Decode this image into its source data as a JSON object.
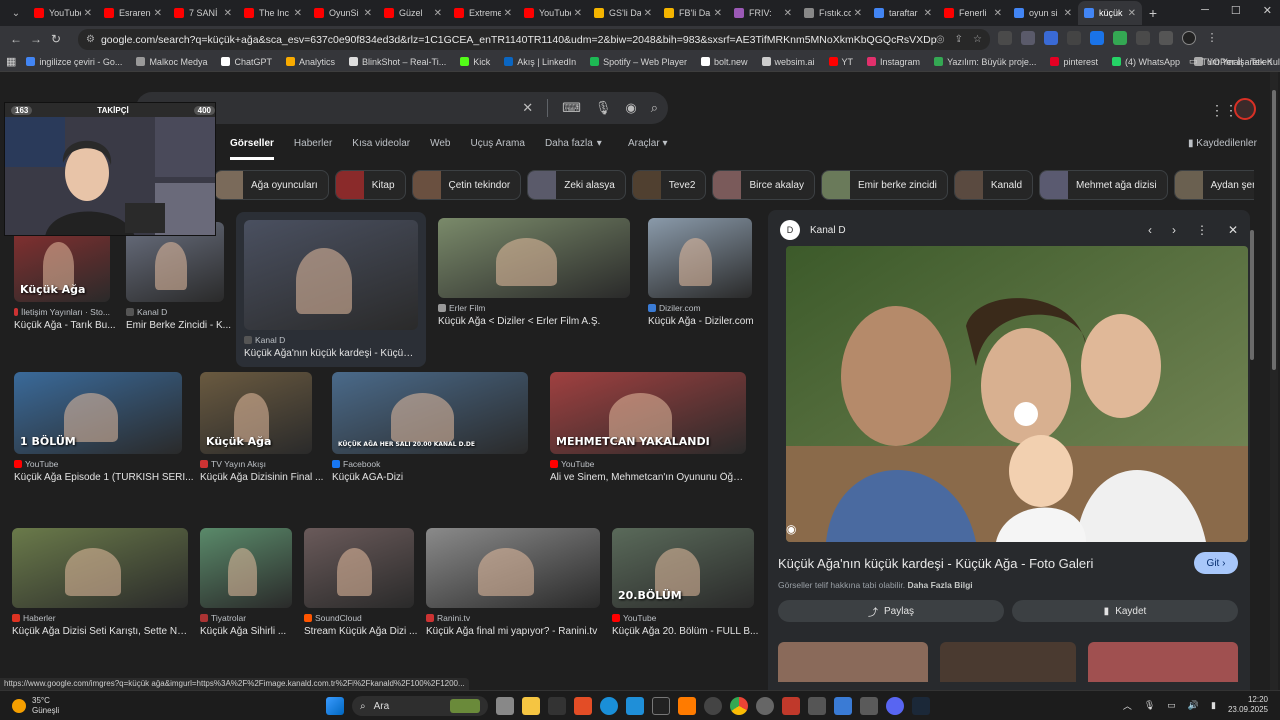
{
  "browser": {
    "tabs": [
      {
        "title": "YouTube",
        "color": "#ff0000"
      },
      {
        "title": "Esrarengiz",
        "color": "#ff0000"
      },
      {
        "title": "7 SANİ",
        "color": "#ff0000"
      },
      {
        "title": "The Inc",
        "color": "#ff0000"
      },
      {
        "title": "OyunSi",
        "color": "#ff0000"
      },
      {
        "title": "Güzel ",
        "color": "#ff0000"
      },
      {
        "title": "Extreme",
        "color": "#ff0000"
      },
      {
        "title": "YouTube",
        "color": "#ff0000"
      },
      {
        "title": "GS'li Da",
        "color": "#f4b400"
      },
      {
        "title": "FB'li Da",
        "color": "#f4b400"
      },
      {
        "title": "FRIV: ",
        "color": "#9b59b6"
      },
      {
        "title": "Fıstık.co",
        "color": "#888888"
      },
      {
        "title": "taraftar",
        "color": "#4285f4"
      },
      {
        "title": "Fenerli",
        "color": "#ff0000"
      },
      {
        "title": "oyun si",
        "color": "#4285f4"
      },
      {
        "title": "küçük a",
        "color": "#4285f4",
        "active": true
      }
    ],
    "url": "google.com/search?q=küçük+ağa&sca_esv=637c0e90f834ed3d&rlz=1C1GCEA_enTR1140TR1140&udm=2&biw=2048&bih=983&sxsrf=AE3TifMRKnm5MNoXkmKbQGQcRsVXDpYzXw%3A1758619211103&ei=S2bSaLC...",
    "bookmarks": [
      {
        "label": "ingilizce çeviri - Go...",
        "color": "#4285f4"
      },
      {
        "label": "Malkoc Medya",
        "color": "#999999"
      },
      {
        "label": "ChatGPT",
        "color": "#ffffff"
      },
      {
        "label": "Analytics",
        "color": "#f9ab00"
      },
      {
        "label": "BlinkShot – Real-Ti...",
        "color": "#dddddd"
      },
      {
        "label": "Kick",
        "color": "#53fc18"
      },
      {
        "label": "Akış | LinkedIn",
        "color": "#0a66c2"
      },
      {
        "label": "Spotify – Web Player",
        "color": "#1db954"
      },
      {
        "label": "bolt.new",
        "color": "#ffffff"
      },
      {
        "label": "websim.ai",
        "color": "#cccccc"
      },
      {
        "label": "YT",
        "color": "#ff0000"
      },
      {
        "label": "Instagram",
        "color": "#e1306c"
      },
      {
        "label": "Yazılım: Büyük proje...",
        "color": "#34a853"
      },
      {
        "label": "pinterest",
        "color": "#e60023"
      },
      {
        "label": "(4) WhatsApp",
        "color": "#25d366"
      },
      {
        "label": "YOPmail - Tek Kulla...",
        "color": "#aaaaaa"
      }
    ],
    "bookmarks_all": "Tüm Yer İşaretleri"
  },
  "search": {
    "query": "küçük ağa",
    "tabs": [
      "Görseller",
      "Haberler",
      "Kısa videolar",
      "Web",
      "Uçuş Arama",
      "Daha fazla"
    ],
    "tools": "Araçlar",
    "saved": "Kaydedilenler",
    "chips": [
      {
        "label": "Ağa oyuncuları",
        "color": "#7a6a5a"
      },
      {
        "label": "Kitap",
        "color": "#8a2a2a"
      },
      {
        "label": "Çetin tekindor",
        "color": "#6a5040"
      },
      {
        "label": "Zeki alasya",
        "color": "#5a5a6a"
      },
      {
        "label": "Teve2",
        "color": "#504030"
      },
      {
        "label": "Birce akalay",
        "color": "#7a5a5a"
      },
      {
        "label": "Emir berke zincidi",
        "color": "#6a7a5a"
      },
      {
        "label": "Kanald",
        "color": "#5a4a40"
      },
      {
        "label": "Mehmet ağa dizisi",
        "color": "#5a5a70"
      },
      {
        "label": "Aydan şener",
        "color": "#6a6050"
      },
      {
        "label": "",
        "color": "#705a50"
      }
    ]
  },
  "results": [
    {
      "source": "İletişim Yayınları · Sto...",
      "title": "Küçük Ağa - Tarık Bu...",
      "overlay": "Küçük Ağa",
      "color": "#8a3030",
      "sico": "#c33"
    },
    {
      "source": "Kanal D",
      "title": "Emir Berke Zincidi - K...",
      "overlay": "",
      "color": "#6a7080",
      "sico": "#555"
    },
    {
      "source": "Kanal D",
      "title": "Küçük Ağa'nın küçük kardeşi - Küçük Ağa ...",
      "overlay": "",
      "color": "#4a5060",
      "sico": "#555"
    },
    {
      "source": "Erler Film",
      "title": "Küçük Ağa < Diziler < Erler Film A.Ş.",
      "overlay": "",
      "color": "#7a8a6a",
      "sico": "#999"
    },
    {
      "source": "Diziler.com",
      "title": "Küçük Ağa - Diziler.com",
      "overlay": "",
      "color": "#8a9aaa",
      "sico": "#3a7bd5"
    },
    {
      "source": "YouTube",
      "title": "Küçük Ağa Episode 1 (TURKISH SERI...",
      "overlay": "1 BÖLÜM",
      "color": "#3a6a9a",
      "sico": "#f00"
    },
    {
      "source": "TV Yayın Akışı",
      "title": "Küçük Ağa Dizisinin Final ...",
      "overlay": "Küçük Ağa",
      "color": "#6a5a40",
      "sico": "#c33"
    },
    {
      "source": "Facebook",
      "title": "Küçük AĞA-Dizi",
      "overlay": "KÜÇÜK AĞA HER SALI 20.00 KANAL D.DE",
      "color": "#4a6a8a",
      "sico": "#1877f2"
    },
    {
      "source": "YouTube",
      "title": "Ali ve Sinem, Mehmetcan'ın Oyununu Öğrendi! ...",
      "overlay": "MEHMETCAN YAKALANDI",
      "color": "#a04040",
      "sico": "#f00"
    },
    {
      "source": "Haberler",
      "title": "Küçük Ağa Dizisi Seti Karıştı, Sette Nele...",
      "overlay": "",
      "color": "#6a7a4a",
      "sico": "#d32"
    },
    {
      "source": "Tiyatrolar",
      "title": "Küçük Ağa Sihirli ...",
      "overlay": "",
      "color": "#5a8a6a",
      "sico": "#a33"
    },
    {
      "source": "SoundCloud",
      "title": "Stream Küçük Ağa Dizi ...",
      "overlay": "",
      "color": "#6a5a5a",
      "sico": "#f50"
    },
    {
      "source": "Ranini.tv",
      "title": "Küçük Ağa final mi yapıyor? - Ranini.tv",
      "overlay": "",
      "color": "#8a8a8a",
      "sico": "#c33"
    },
    {
      "source": "YouTube",
      "title": "Küçük Ağa 20. Bölüm - FULL B...",
      "overlay": "20.BÖLÜM",
      "color": "#5a6a5a",
      "sico": "#f00"
    }
  ],
  "preview": {
    "source": "Kanal D",
    "logo": "D",
    "title": "Küçük Ağa'nın küçük kardeşi - Küçük Ağa - Foto Galeri",
    "visit": "Git",
    "copyright": "Görseller telif hakkına tabi olabilir.",
    "more_info": "Daha Fazla Bilgi",
    "share": "Paylaş",
    "save": "Kaydet"
  },
  "webcam": {
    "left_count": "163",
    "label": "TAKİPÇİ",
    "right_count": "400"
  },
  "status_url": "https://www.google.com/imgres?q=küçük ağa&imgurl=https%3A%2F%2Fimage.kanald.com.tr%2Fi%2Fkanald%2F100%2F1200...",
  "taskbar": {
    "temp": "35°C",
    "weather": "Güneşli",
    "search": "Ara",
    "time": "12:20",
    "date": "23.09.2025"
  }
}
